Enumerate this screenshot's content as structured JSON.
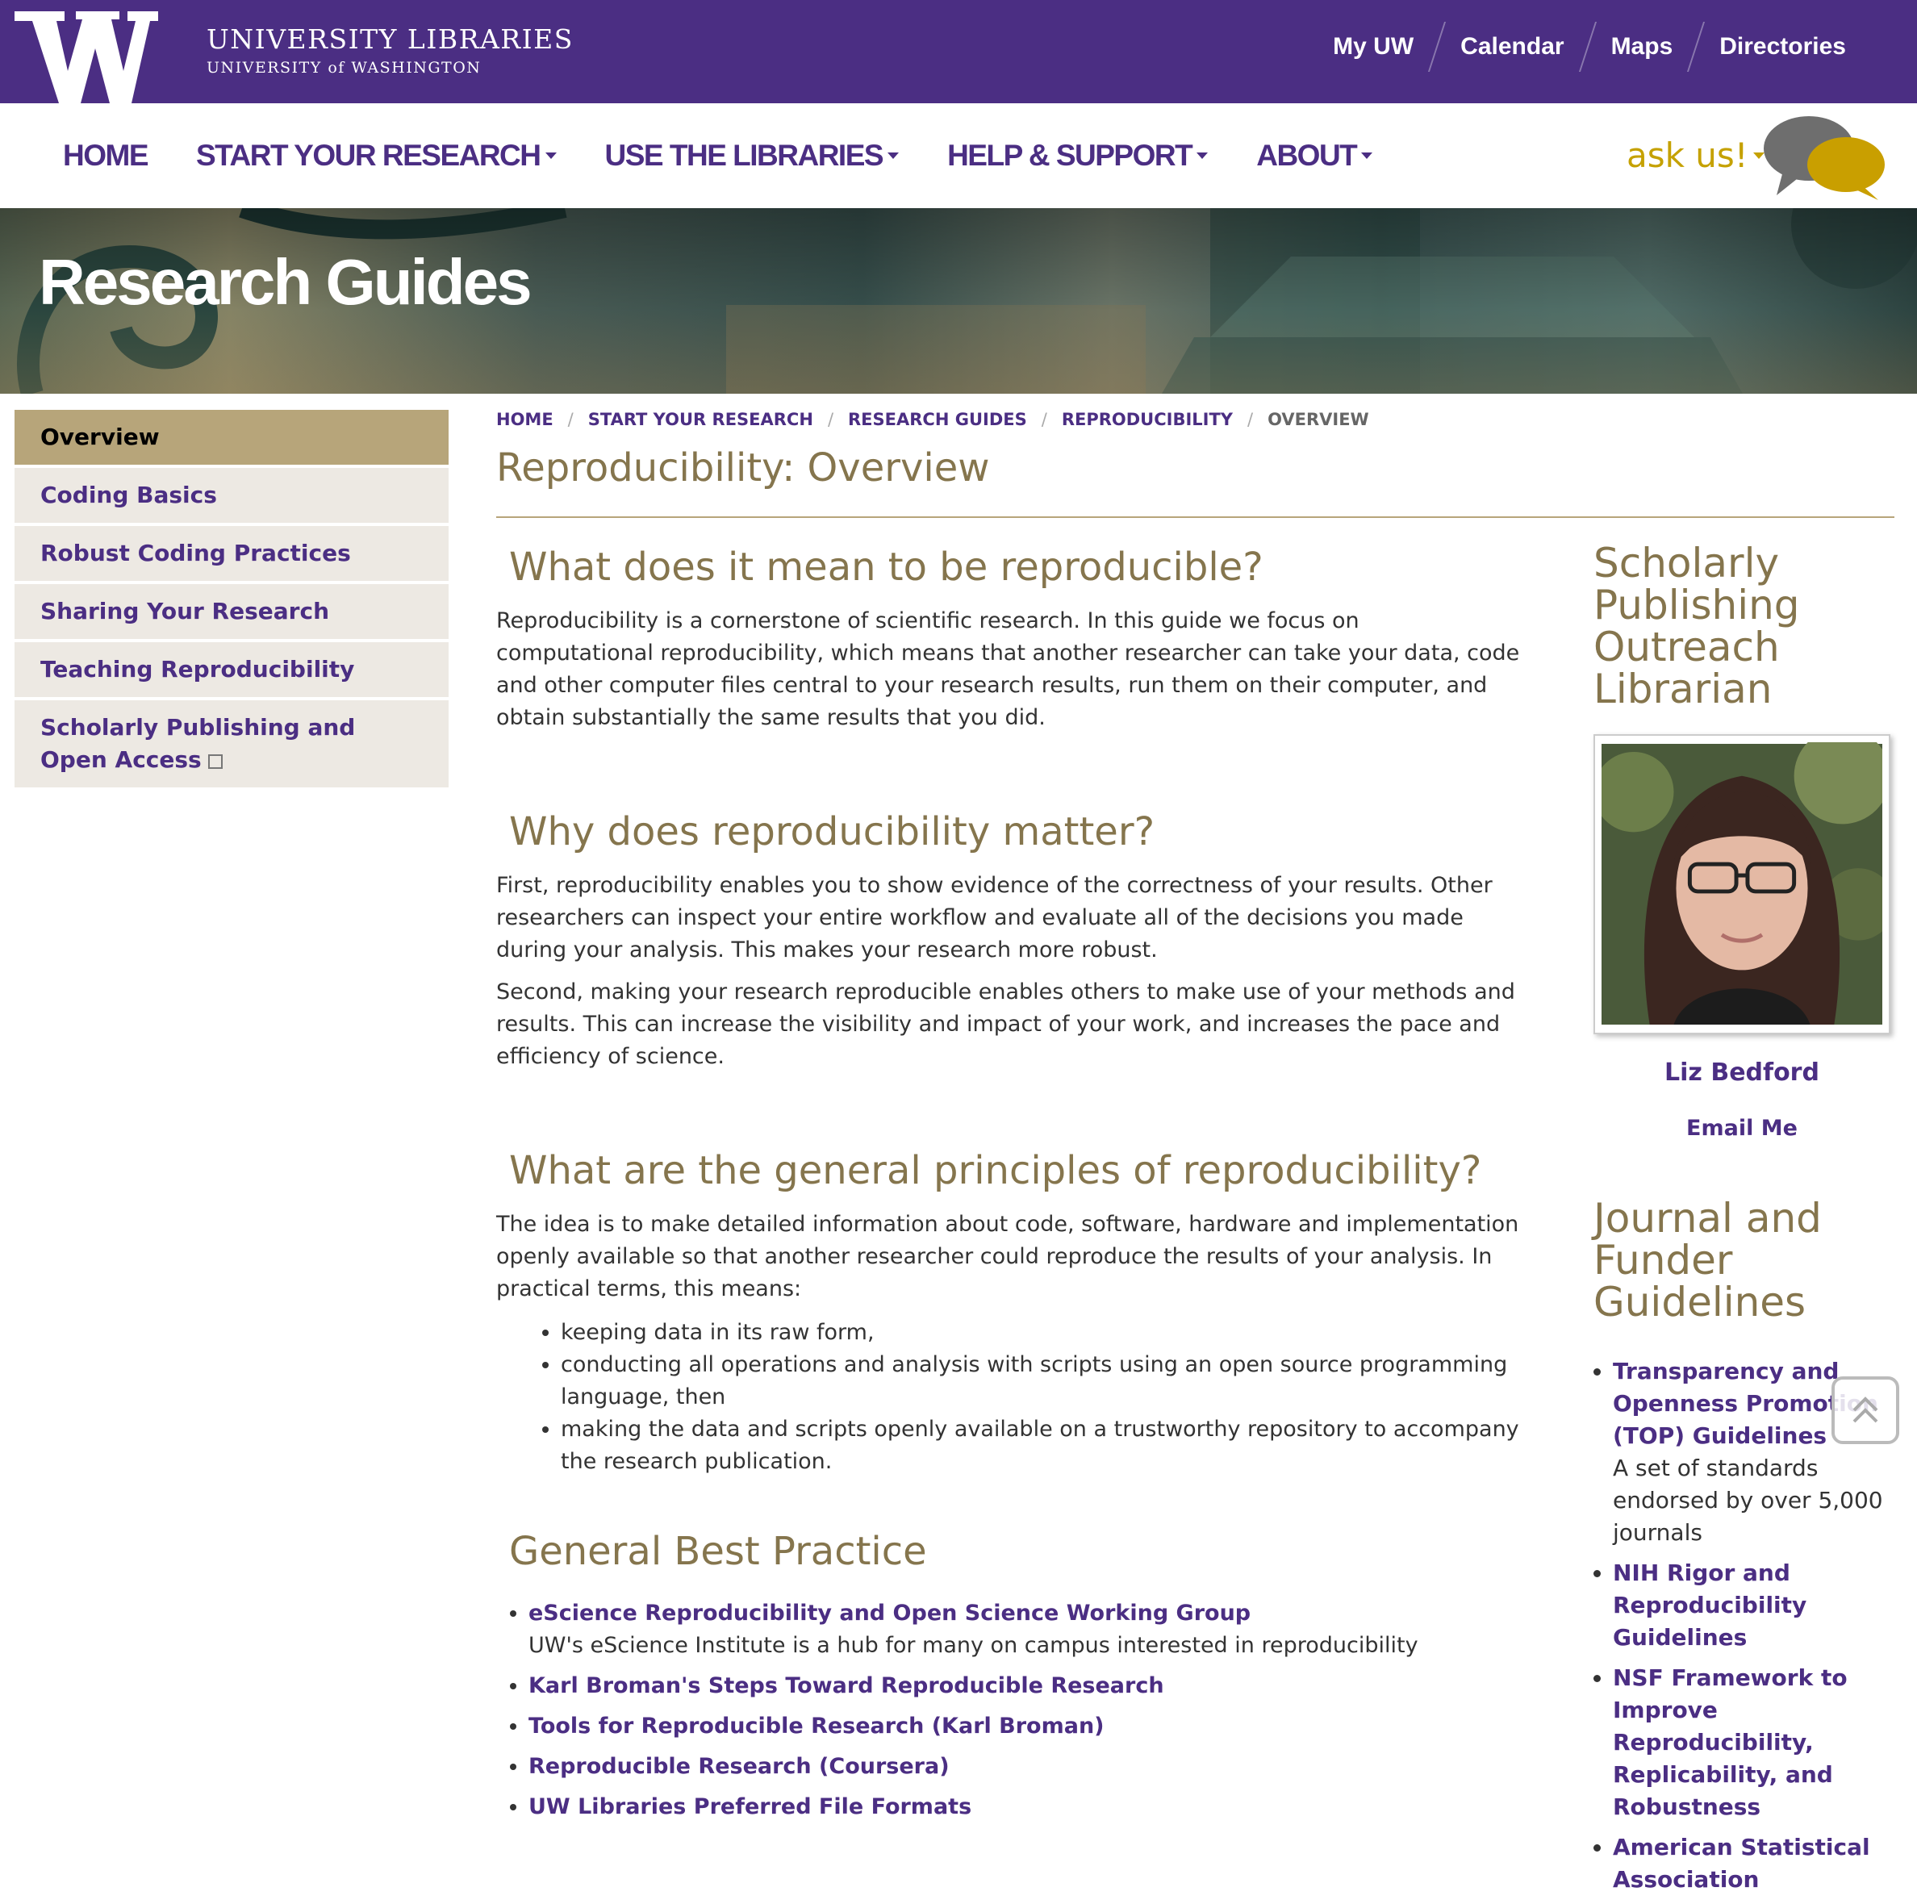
{
  "header": {
    "logo_letter": "W",
    "brand_title": "UNIVERSITY LIBRARIES",
    "brand_sub": "UNIVERSITY of WASHINGTON",
    "links": [
      "My UW",
      "Calendar",
      "Maps",
      "Directories"
    ],
    "purple": "#4b2e83",
    "gold": "#c5a100"
  },
  "nav": {
    "items": [
      "HOME",
      "START YOUR RESEARCH",
      "USE THE LIBRARIES",
      "HELP & SUPPORT",
      "ABOUT"
    ],
    "askus": "ask us!"
  },
  "hero": {
    "title": "Research Guides"
  },
  "sidebar": {
    "items": [
      {
        "label": "Overview"
      },
      {
        "label": "Coding Basics"
      },
      {
        "label": "Robust Coding Practices"
      },
      {
        "label": "Sharing Your Research"
      },
      {
        "label": "Teaching Reproducibility"
      },
      {
        "label": "Scholarly Publishing and Open Access"
      }
    ]
  },
  "breadcrumb": [
    "HOME",
    "START YOUR RESEARCH",
    "RESEARCH GUIDES",
    "REPRODUCIBILITY",
    "OVERVIEW"
  ],
  "page_title": "Reproducibility: Overview",
  "sections": {
    "s1_heading": "What does it mean to be reproducible?",
    "s1_p1": "Reproducibility is a cornerstone of scientific research. In this guide we focus on computational reproducibility, which means that another researcher can take your data, code and other computer files central to your research results, run them on their computer, and obtain substantially the same results that you did.",
    "s2_heading": "Why does reproducibility matter?",
    "s2_p1": "First, reproducibility enables you to show evidence of the correctness of your results. Other researchers can inspect your entire workflow and evaluate all of the decisions you made during your analysis. This makes your research more robust.",
    "s2_p2": "Second, making your research reproducible enables others to make use of your methods and results. This can increase the visibility and impact of your work, and increases the pace and efficiency of science.",
    "s3_heading": "What are the general principles of reproducibility?",
    "s3_p1": "The idea is to make detailed information about code, software, hardware and implementation openly available so that another researcher could reproduce the results of your analysis. In practical terms, this means:",
    "s3_bullets": [
      "keeping data in its raw form,",
      "conducting all operations and analysis with scripts using an open source programming language, then",
      "making the data and scripts openly available on a trustworthy repository to accompany the research publication."
    ],
    "s4_heading": "General Best Practice",
    "s4_links": [
      {
        "label": "eScience Reproducibility and Open Science Working Group",
        "desc": "UW's eScience Institute is a hub for many on campus interested in reproducibility"
      },
      {
        "label": "Karl Broman's Steps Toward Reproducible Research",
        "desc": ""
      },
      {
        "label": "Tools for Reproducible Research (Karl Broman)",
        "desc": ""
      },
      {
        "label": "Reproducible Research (Coursera)",
        "desc": ""
      },
      {
        "label": "UW Libraries Preferred File Formats",
        "desc": ""
      }
    ]
  },
  "right": {
    "librarian_heading": "Scholarly Publishing Outreach Librarian",
    "librarian_name": "Liz Bedford",
    "email_label": "Email Me",
    "guidelines_heading": "Journal and Funder Guidelines",
    "guidelines": [
      {
        "label": "Transparency and Openness Promotion (TOP) Guidelines",
        "desc": "A set of standards endorsed by over 5,000 journals"
      },
      {
        "label": "NIH Rigor and Reproducibility Guidelines",
        "desc": ""
      },
      {
        "label": "NSF Framework to Improve Reproducibility, Replicability, and Robustness",
        "desc": ""
      },
      {
        "label": "American Statistical Association",
        "desc": ""
      }
    ]
  },
  "icons": [
    "w-logo-icon",
    "askus-bubbles-icon",
    "external-link-icon",
    "back-to-top-icon"
  ]
}
